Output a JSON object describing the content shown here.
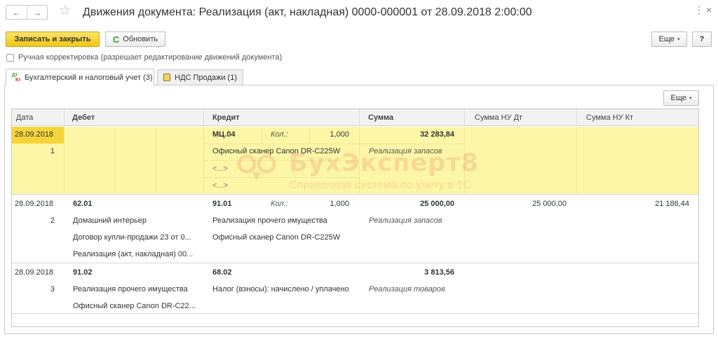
{
  "window": {
    "title": "Движения документа: Реализация (акт, накладная) 0000-000001 от 28.09.2018 2:00:00",
    "back_glyph": "←",
    "forward_glyph": "→",
    "star_glyph": "☆",
    "more_glyph": "⋮",
    "close_glyph": "×"
  },
  "toolbar": {
    "save_close_label": "Записать и закрыть",
    "refresh_label": "Обновить",
    "refresh_glyph": "C",
    "more_label": "Еще",
    "caret_glyph": "▾",
    "help_label": "?"
  },
  "manual_correction": {
    "label": "Ручная корректировка (разрешает редактирование движений документа)",
    "checked": false
  },
  "tabs": [
    {
      "label": "Бухгалтерский и налоговый учет (3)",
      "icon": "dt-kt-icon",
      "icon_top": "Дт",
      "icon_bottom": "Кт",
      "active": true
    },
    {
      "label": "НДС Продажи (1)",
      "icon": "register-icon",
      "active": false
    }
  ],
  "table_toolbar": {
    "more_label": "Еще"
  },
  "table": {
    "columns": [
      "Дата",
      "Дебет",
      "Кредит",
      "Сумма",
      "Сумма НУ Дт",
      "Сумма НУ Кт"
    ],
    "rows": [
      {
        "date": "28.09.2018",
        "num": "1",
        "debit": [
          "",
          "",
          ""
        ],
        "credit_account": "МЦ.04",
        "qty_label": "Кол.:",
        "qty": "1,000",
        "credit_sub": [
          "Офисный сканер Canon DR-C225W",
          "<...>",
          "<...>"
        ],
        "sum": "32 283,84",
        "sum_note": "Реализация запасов",
        "nu_dt": "",
        "nu_kt": "",
        "selected": true
      },
      {
        "date": "28.09.2018",
        "num": "2",
        "debit_account": "62.01",
        "debit": [
          "Домашний интерьер",
          "Договор купли-продажи 23 от 0...",
          "Реализация (акт, накладная) 00..."
        ],
        "credit_account": "91.01",
        "qty_label": "Кол.:",
        "qty": "1,000",
        "credit_sub": [
          "Реализация прочего имущества",
          "Офисный сканер Canon DR-C225W"
        ],
        "sum": "25 000,00",
        "sum_note": "Реализация запасов",
        "nu_dt": "25 000,00",
        "nu_kt": "21 186,44",
        "selected": false
      },
      {
        "date": "28.09.2018",
        "num": "3",
        "debit_account": "91.02",
        "debit": [
          "Реализация прочего имущества",
          "Офисный сканер Canon DR-C22..."
        ],
        "credit_account": "68.02",
        "credit_sub": [
          "Налог (взносы): начислено / уплачено"
        ],
        "sum": "3 813,56",
        "sum_note": "Реализация товаров",
        "nu_dt": "",
        "nu_kt": "",
        "selected": false
      }
    ]
  },
  "watermark": {
    "brand": "БухЭксперт8",
    "tagline": "Справочная система по учету в 1С"
  },
  "colors": {
    "primary_button": "#f1c716",
    "selected_row": "#fdf6a6",
    "selected_date": "#f6d53c",
    "watermark": "#dc5a3c"
  }
}
